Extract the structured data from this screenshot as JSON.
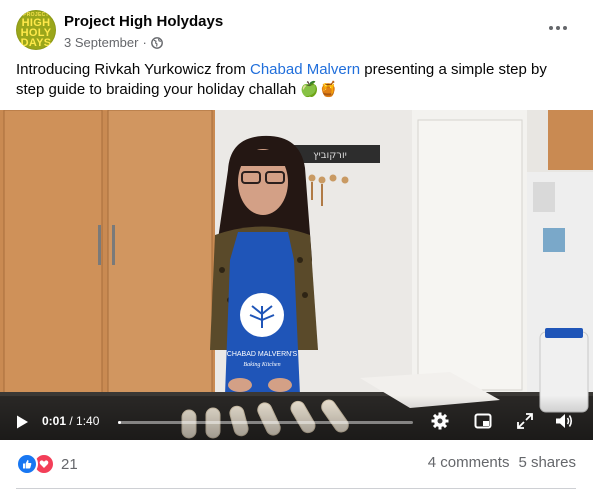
{
  "post": {
    "page_name": "Project High Holydays",
    "avatar_text": [
      "PROJECT",
      "HIGH",
      "HOLY",
      "DAYS"
    ],
    "date": "3 September",
    "dot": "·",
    "caption_before": "Introducing Rivkah Yurkowicz from ",
    "caption_link": "Chabad Malvern",
    "caption_after": " presenting a simple step by step guide to braiding your holiday challah 🍏🍯"
  },
  "video": {
    "current_time": "0:01",
    "separator": " / ",
    "duration": "1:40",
    "progress_fraction": 0.01,
    "apron_text_1": "CHABAD MALVERN'S",
    "apron_text_2": "Baking Kitchen",
    "sign_text": "יורקוביץ"
  },
  "footer": {
    "reaction_count": "21",
    "comments": "4 comments",
    "shares": "5 shares"
  },
  "colors": {
    "link": "#216fdb",
    "like": "#1877f2",
    "love": "#f33e58",
    "apron": "#1f55b8"
  },
  "icons": [
    "globe-icon",
    "more-icon",
    "play-icon",
    "settings-icon",
    "miniplayer-icon",
    "fullscreen-icon",
    "volume-icon",
    "like-icon",
    "love-icon"
  ]
}
